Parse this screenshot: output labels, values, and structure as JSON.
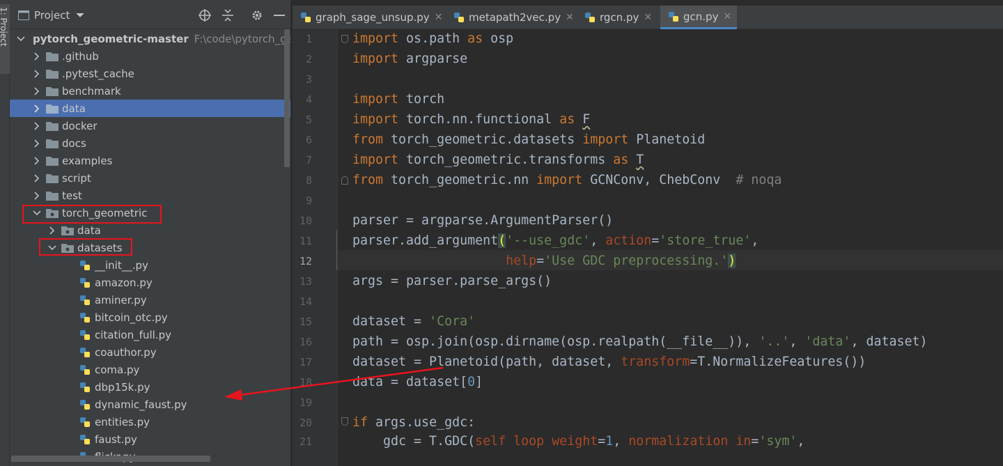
{
  "toolstrip": {
    "project_label": "1: Project"
  },
  "project_panel": {
    "title": "Project",
    "tree": [
      {
        "label": "pytorch_geometric-master",
        "hint": "F:\\code\\pytorch_ge"
      },
      {
        "label": ".github"
      },
      {
        "label": ".pytest_cache"
      },
      {
        "label": "benchmark"
      },
      {
        "label": "data"
      },
      {
        "label": "docker"
      },
      {
        "label": "docs"
      },
      {
        "label": "examples"
      },
      {
        "label": "script"
      },
      {
        "label": "test"
      },
      {
        "label": "torch_geometric"
      },
      {
        "label": "data"
      },
      {
        "label": "datasets"
      },
      {
        "label": "__init__.py"
      },
      {
        "label": "amazon.py"
      },
      {
        "label": "aminer.py"
      },
      {
        "label": "bitcoin_otc.py"
      },
      {
        "label": "citation_full.py"
      },
      {
        "label": "coauthor.py"
      },
      {
        "label": "coma.py"
      },
      {
        "label": "dbp15k.py"
      },
      {
        "label": "dynamic_faust.py"
      },
      {
        "label": "entities.py"
      },
      {
        "label": "faust.py"
      },
      {
        "label": "flickr.py"
      }
    ]
  },
  "tabs": [
    {
      "label": "graph_sage_unsup.py"
    },
    {
      "label": "metapath2vec.py"
    },
    {
      "label": "rgcn.py"
    },
    {
      "label": "gcn.py"
    }
  ],
  "editor": {
    "line_numbers": [
      "1",
      "2",
      "3",
      "4",
      "5",
      "6",
      "7",
      "8",
      "9",
      "10",
      "11",
      "12",
      "13",
      "14",
      "15",
      "16",
      "17",
      "18",
      "19",
      "20",
      "21"
    ],
    "current_line": "12"
  },
  "colors": {
    "selection": "#4b6eaf",
    "annotation_red": "#e8141e",
    "keyword": "#cc7832",
    "string": "#6a8759",
    "number": "#6897bb"
  }
}
